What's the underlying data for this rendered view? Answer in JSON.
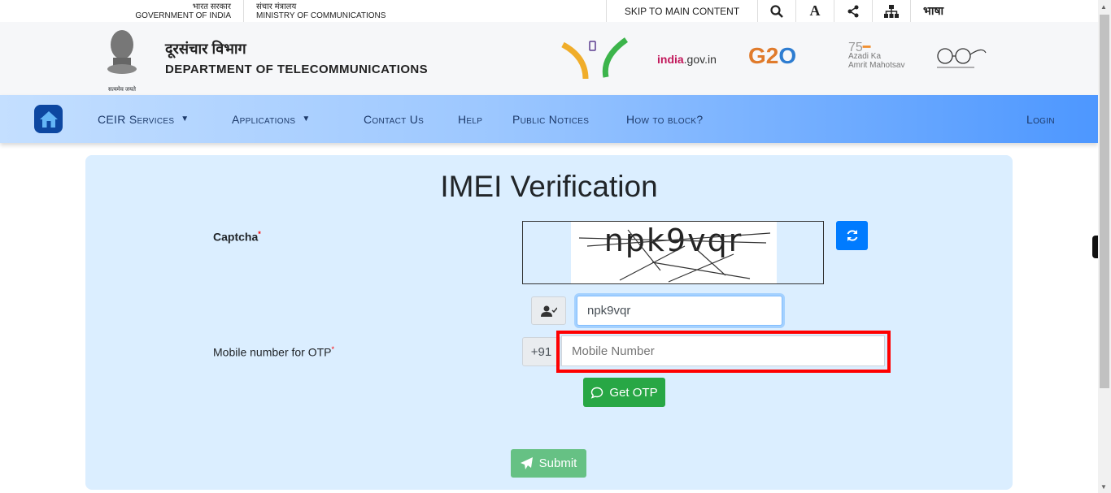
{
  "topbar": {
    "gov_hi": "भारत सरकार",
    "gov_en": "GOVERNMENT OF INDIA",
    "ministry_hi": "संचार मंत्रालय",
    "ministry_en": "MINISTRY OF COMMUNICATIONS",
    "skip": "SKIP TO MAIN CONTENT",
    "language": "भाषा",
    "icons": [
      "search-icon",
      "font-size-icon",
      "share-icon",
      "sitemap-icon"
    ]
  },
  "header": {
    "title_hi": "दूरसंचार विभाग",
    "title_en": "DEPARTMENT OF TELECOMMUNICATIONS",
    "emblem_motto": "सत्यमेव जयते",
    "logos": [
      "Sanchar Saathi",
      "india.gov.in",
      "G20",
      "Azadi Ka Amrit Mahotsav",
      "Swachh Bharat"
    ]
  },
  "nav": {
    "items": [
      "CEIR Services",
      "Applications",
      "Contact Us",
      "Help",
      "Public Notices",
      "How to block?"
    ],
    "login": "Login"
  },
  "form": {
    "title": "IMEI Verification",
    "captcha_label": "Captcha",
    "captcha_image_text": "npk9vqr",
    "captcha_value": "npk9vqr",
    "mobile_label": "Mobile number for OTP",
    "required_mark": "*",
    "country_code": "+91",
    "mobile_placeholder": "Mobile Number",
    "get_otp": "Get OTP",
    "submit": "Submit"
  },
  "colors": {
    "highlight": "#ff0000",
    "green": "#28a745",
    "blue": "#007bff"
  }
}
